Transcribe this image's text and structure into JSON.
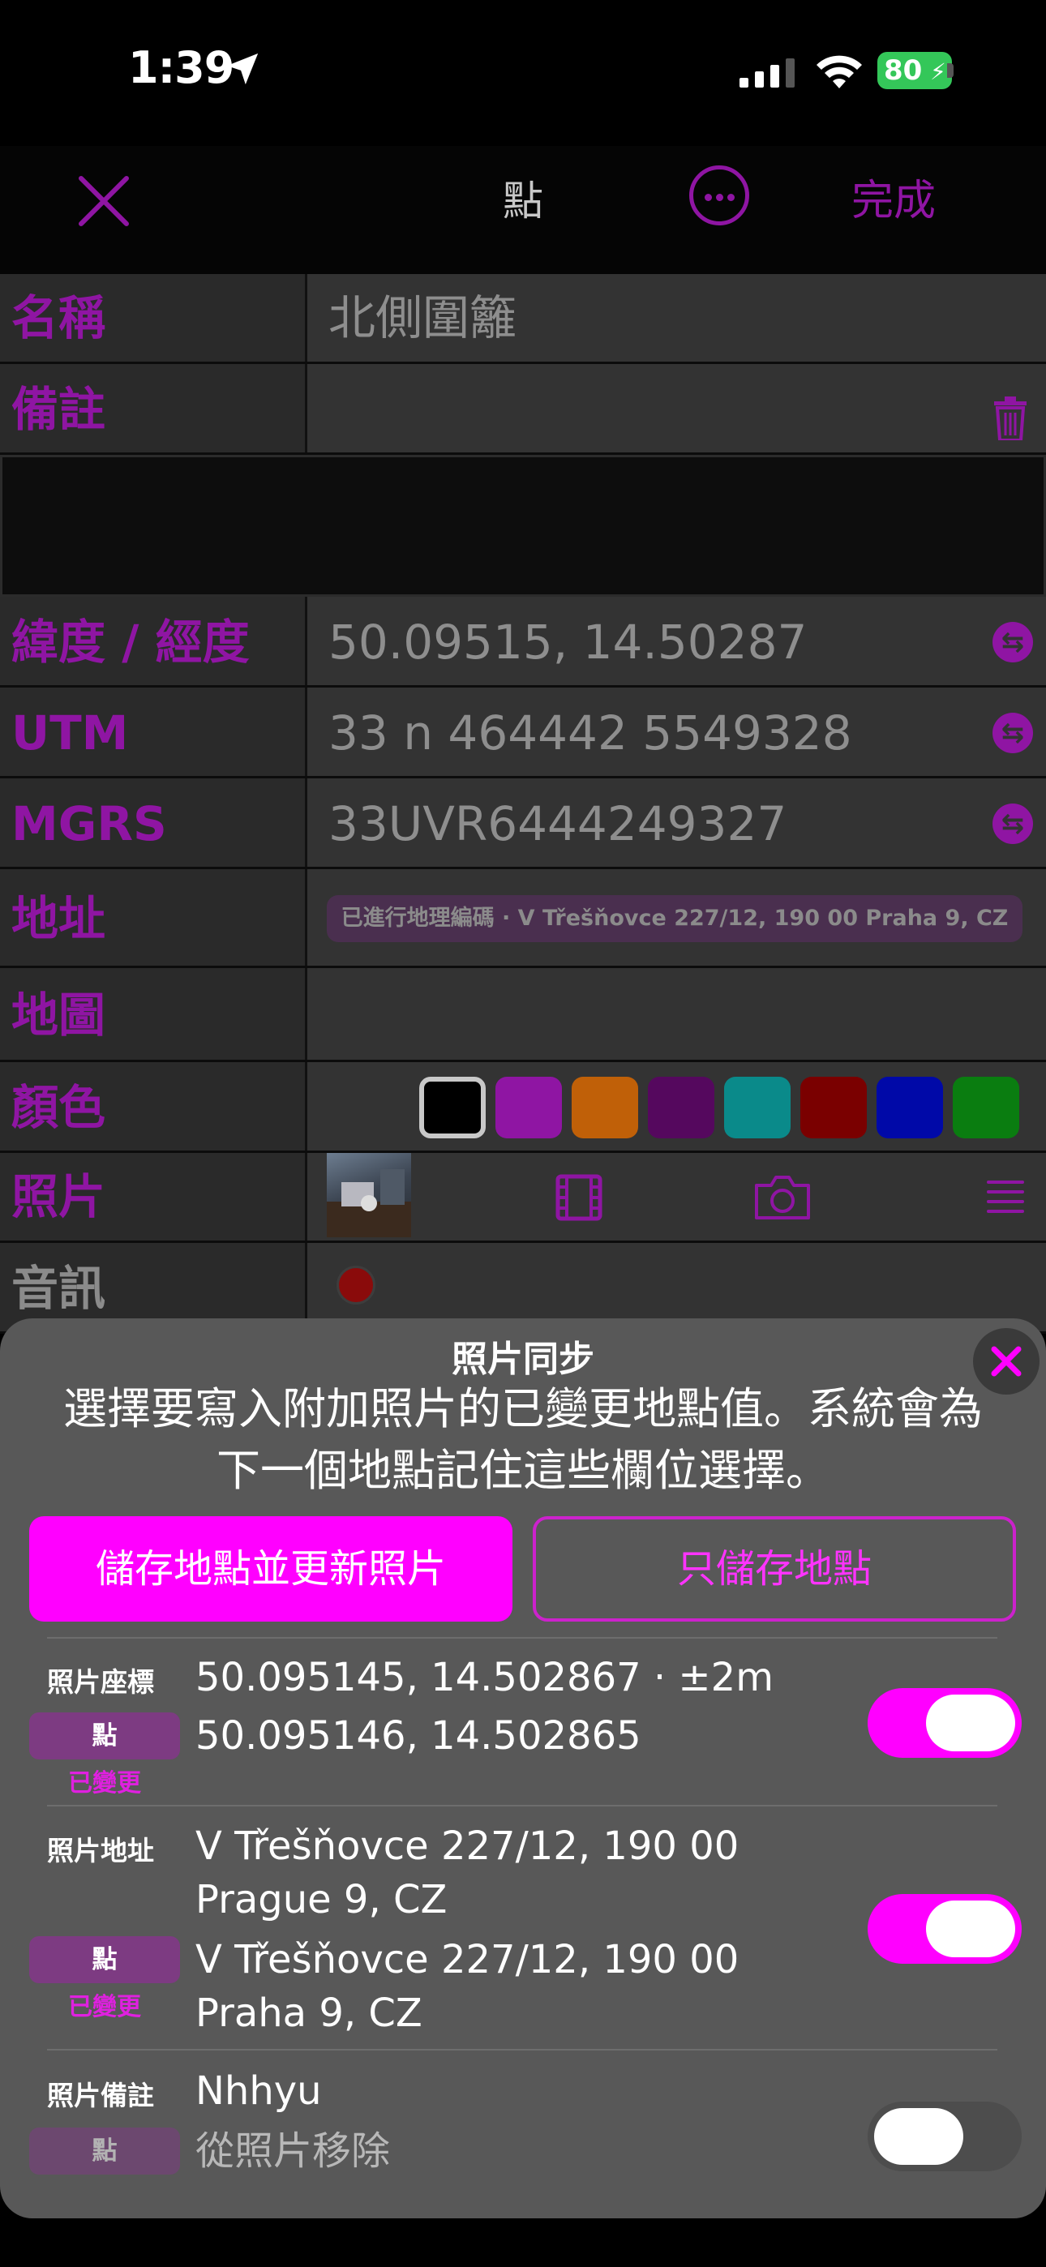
{
  "status": {
    "time": "1:39",
    "battery": "80"
  },
  "nav": {
    "title": "點",
    "done": "完成"
  },
  "rows": {
    "name": {
      "label": "名稱",
      "value": "北側圍籬"
    },
    "notes": {
      "label": "備註"
    },
    "latlon": {
      "label": "緯度 / 經度",
      "value": "50.09515, 14.50287"
    },
    "utm": {
      "label": "UTM",
      "value": "33 n 464442 5549328"
    },
    "mgrs": {
      "label": "MGRS",
      "value": "33UVR6444249327"
    },
    "address": {
      "label": "地址",
      "value": "已進行地理編碼 · V Třešňovce 227/12, 190 00 Praha 9, CZ"
    },
    "map": {
      "label": "地圖"
    },
    "color": {
      "label": "顏色",
      "swatches": [
        "#000000",
        "#8f15a3",
        "#c06008",
        "#55085e",
        "#0a8a8a",
        "#7a0000",
        "#0009a8",
        "#0a7d10"
      ],
      "selected": "#000000"
    },
    "photos": {
      "label": "照片"
    },
    "audio": {
      "label": "音訊"
    }
  },
  "sheet": {
    "title": "照片同步",
    "description": "選擇要寫入附加照片的已變更地點值。系統會為下一個地點記住這些欄位選擇。",
    "primary_button": "儲存地點並更新照片",
    "secondary_button": "只儲存地點",
    "items": [
      {
        "label": "照片座標",
        "tag": "點",
        "status": "已變更",
        "photo_value": "50.095145, 14.502867 · ±2m",
        "point_value": "50.095146, 14.502865",
        "enabled": true
      },
      {
        "label": "照片地址",
        "tag": "點",
        "status": "已變更",
        "photo_value": "V Třešňovce 227/12, 190 00 Prague 9, CZ",
        "point_value": "V Třešňovce 227/12, 190 00 Praha 9, CZ",
        "enabled": true
      },
      {
        "label": "照片備註",
        "tag": "點",
        "photo_value": "Nhhyu",
        "point_value": "從照片移除",
        "enabled": false
      }
    ]
  }
}
